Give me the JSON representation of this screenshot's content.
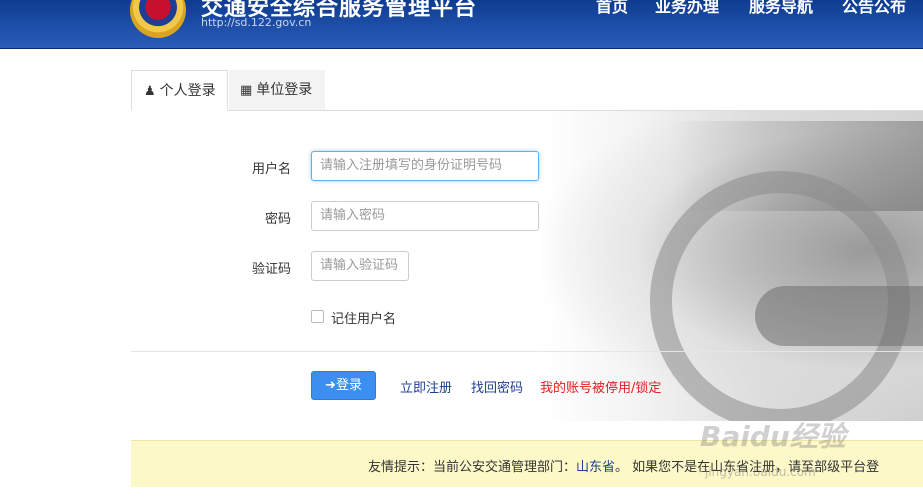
{
  "header": {
    "site_title": "交通安全综合服务管理平台",
    "site_url": "http://sd.122.gov.cn",
    "nav": [
      "首页",
      "业务办理",
      "服务导航",
      "公告公布"
    ]
  },
  "tabs": [
    {
      "label": "个人登录",
      "icon": "user-icon",
      "active": true
    },
    {
      "label": "单位登录",
      "icon": "building-icon",
      "active": false
    }
  ],
  "form": {
    "username_label": "用户名",
    "username_placeholder": "请输入注册填写的身份证明号码",
    "password_label": "密码",
    "password_placeholder": "请输入密码",
    "captcha_label": "验证码",
    "captcha_placeholder": "请输入验证码",
    "remember_label": "记住用户名",
    "login_button": "登录",
    "register_link": "立即注册",
    "recover_link": "找回密码",
    "locked_link": "我的账号被停用/锁定"
  },
  "notice": {
    "prefix": "友情提示：当前公安交通管理部门：",
    "province": "山东省",
    "suffix": "。 如果您不是在山东省注册，请至部级平台登"
  },
  "watermark": {
    "brand": "Baidu经验",
    "url": "jingyan.baidu.com"
  },
  "colors": {
    "header_bg": "#1e4ea8",
    "button_bg": "#3b8ff0",
    "link": "#1f3f8f",
    "warning_link": "#e02020",
    "notice_bg": "#fcf8c8"
  }
}
